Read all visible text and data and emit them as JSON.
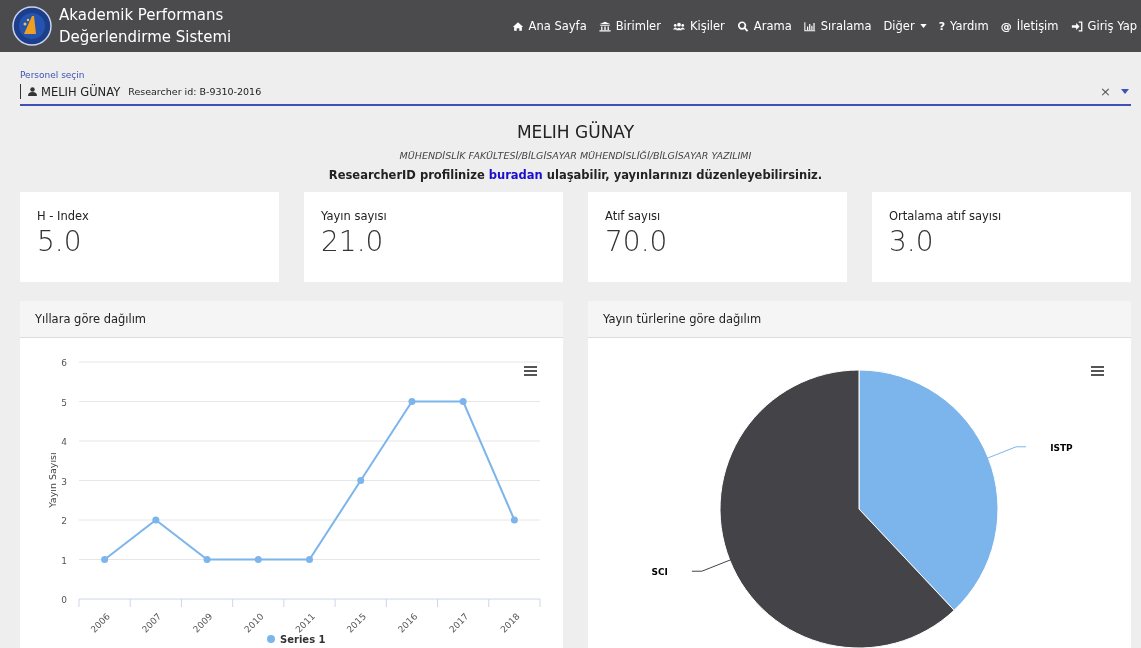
{
  "brand": {
    "line_1": "Akademik Performans",
    "line_2": "Değerlendirme Sistemi"
  },
  "nav": [
    {
      "label": "Ana Sayfa",
      "kind": "link"
    },
    {
      "label": "Birimler",
      "kind": "link"
    },
    {
      "label": "Kişiler",
      "kind": "link"
    },
    {
      "label": "Arama",
      "kind": "link"
    },
    {
      "label": "Sıralama",
      "kind": "link"
    },
    {
      "label": "Diğer",
      "kind": "dropdown"
    },
    {
      "label": "Yardım",
      "kind": "link",
      "glyph": "?"
    },
    {
      "label": "İletişim",
      "kind": "link",
      "glyph": "@"
    },
    {
      "label": "Giriş Yap",
      "kind": "link"
    }
  ],
  "person_select": {
    "label": "Personel seçin",
    "value": "MELIH GÜNAY",
    "detail": "Researcher id: B-9310-2016",
    "clear": "×"
  },
  "profile": {
    "name": "MELIH GÜNAY",
    "unit": "MÜHENDİSLİK FAKÜLTESİ/BİLGİSAYAR MÜHENDİSLİĞİ/BİLGİSAYAR YAZILIMI",
    "note_before": "ResearcherID profilinize",
    "link": "buradan",
    "note_after": "ulaşabilir, yayınlarınızı düzenleyebilirsiniz."
  },
  "stats": [
    {
      "label": "H - Index",
      "value": "5.0"
    },
    {
      "label": "Yayın sayısı",
      "value": "21.0"
    },
    {
      "label": "Atıf sayısı",
      "value": "70.0"
    },
    {
      "label": "Ortalama atıf sayısı",
      "value": "3.0"
    }
  ],
  "panels": [
    {
      "title": "Yıllara göre dağılım",
      "chart_data": {
        "type": "line",
        "ylabel": "Yayın Sayısı",
        "categories": [
          "2006",
          "2007",
          "2009",
          "2010",
          "2011",
          "2015",
          "2016",
          "2017",
          "2018"
        ],
        "series": [
          {
            "name": "Series 1",
            "color": "#7cb5ec",
            "marker": true,
            "values": [
              1,
              2,
              1,
              1,
              1,
              3,
              5,
              5,
              2
            ]
          }
        ],
        "ylim": [
          0,
          6
        ],
        "yticks": [
          0,
          1,
          2,
          3,
          4,
          5,
          6
        ],
        "grid": true
      }
    },
    {
      "title": "Yayın türlerine göre dağılım",
      "chart_data": {
        "type": "pie",
        "categories": [
          "ISTP",
          "SCI"
        ],
        "series": [
          {
            "colors": [
              "#7cb5ec",
              "#434348"
            ],
            "values": [
              38,
              62
            ]
          }
        ]
      }
    }
  ]
}
